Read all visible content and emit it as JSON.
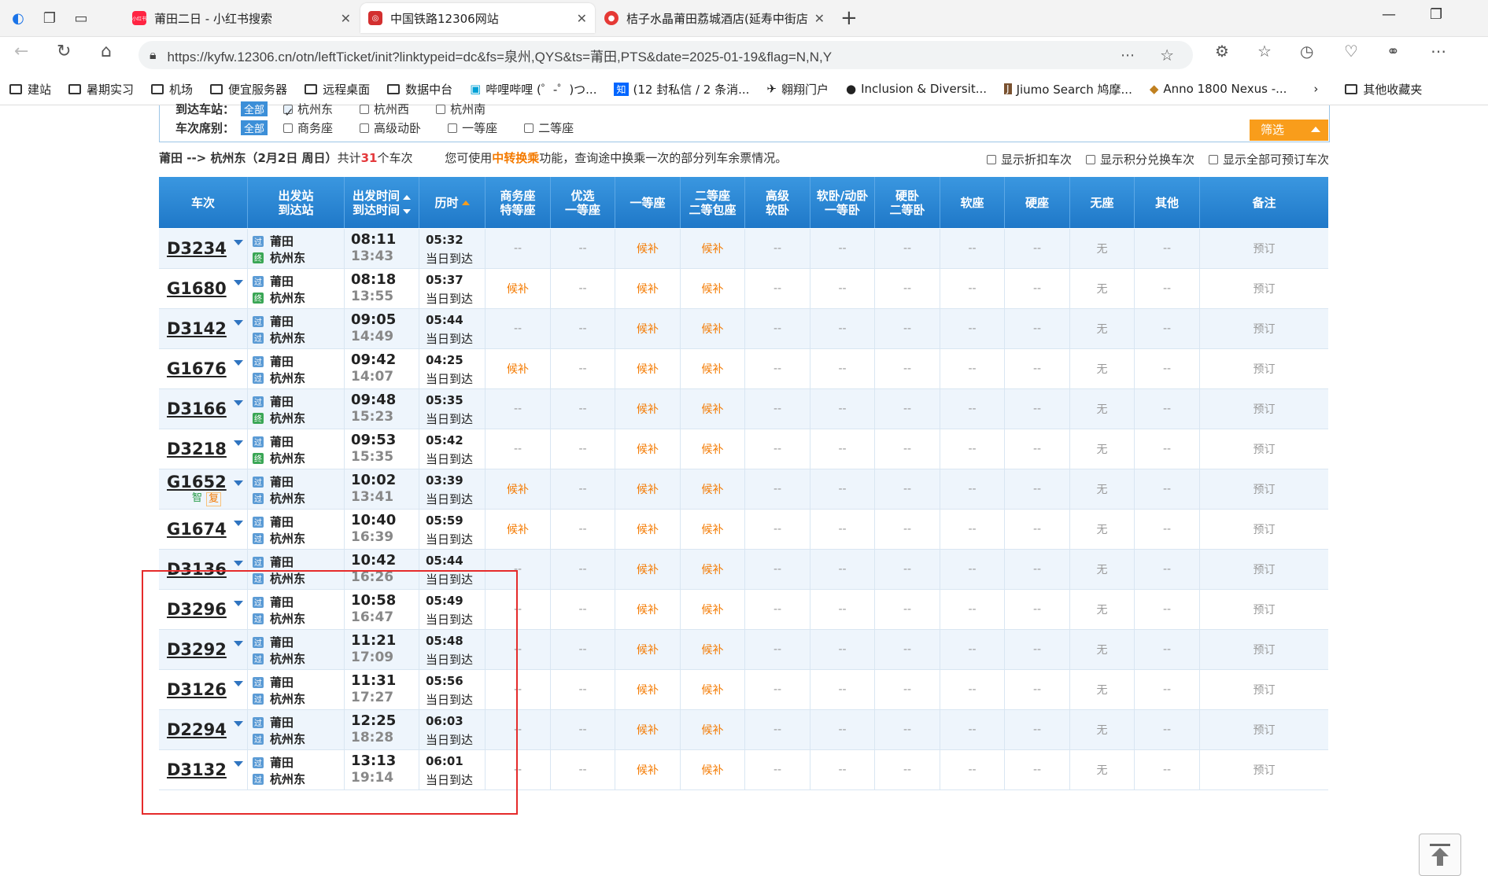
{
  "browser": {
    "tabs": [
      {
        "title": "莆田二日 - 小红书搜索",
        "fav_color": "#ff2442",
        "fav_text": "小红书"
      },
      {
        "title": "中国铁路12306网站",
        "fav_color": "#d32f2f",
        "fav_text": "◎"
      },
      {
        "title": "桔子水晶莆田荔城酒店(延寿中街店",
        "fav_color": "#e53935",
        "fav_text": "●"
      }
    ],
    "url": "https://kyfw.12306.cn/otn/leftTicket/init?linktypeid=dc&fs=泉州,QYS&ts=莆田,PTS&date=2025-01-19&flag=N,N,Y",
    "bookmarks": [
      "建站",
      "暑期实习",
      "机场",
      "便宜服务器",
      "远程桌面",
      "数据中台",
      "哔哩哔哩 (゜-゜)つ...",
      "(12 封私信 / 2 条消...",
      "翱翔门户",
      "Inclusion & Diversit...",
      "Jiumo Search 鸠摩...",
      "Anno 1800 Nexus -...",
      "其他收藏夹"
    ]
  },
  "filter": {
    "arrive_label": "到达车站：",
    "arrive_all": "全部",
    "arrive_opts": [
      "杭州东",
      "杭州西",
      "杭州南"
    ],
    "seat_label": "车次席别：",
    "seat_all": "全部",
    "seat_opts": [
      "商务座",
      "高级动卧",
      "一等座",
      "二等座"
    ],
    "screen_btn": "筛选"
  },
  "summary": {
    "route": "莆田 --> 杭州东（2月2日  周日）",
    "total_prefix": "共计",
    "total": "31",
    "total_suffix": "个车次",
    "tip1": "您可使用",
    "tip_hl": "中转换乘",
    "tip2": "功能，查询途中换乘一次的部分列车余票情况。",
    "opt1": "显示折扣车次",
    "opt2": "显示积分兑换车次",
    "opt3": "显示全部可预订车次"
  },
  "headers": {
    "train": "车次",
    "station1": "出发站",
    "station2": "到达站",
    "time1": "出发时间",
    "time2": "到达时间",
    "duration": "历时",
    "biz1": "商务座",
    "biz2": "特等座",
    "pref1": "优选",
    "pref2": "一等座",
    "first": "一等座",
    "second1": "二等座",
    "second2": "二等包座",
    "high1": "高级",
    "high2": "软卧",
    "soft1": "软卧/动卧",
    "soft2": "一等卧",
    "hard1": "硬卧",
    "hard2": "二等卧",
    "softseat": "软座",
    "hardseat": "硬座",
    "noseat": "无座",
    "other": "其他",
    "note": "备注"
  },
  "rows": [
    {
      "no": "D3234",
      "from": "莆田",
      "to": "杭州东",
      "dep": "08:11",
      "arr": "13:43",
      "dur": "05:32",
      "day": "当日到达",
      "biz": "--",
      "first": "候补",
      "second": "候补",
      "noseat": "无",
      "note": "预订",
      "to_icon": "终"
    },
    {
      "no": "G1680",
      "from": "莆田",
      "to": "杭州东",
      "dep": "08:18",
      "arr": "13:55",
      "dur": "05:37",
      "day": "当日到达",
      "biz": "候补",
      "first": "候补",
      "second": "候补",
      "noseat": "无",
      "note": "预订",
      "to_icon": "终"
    },
    {
      "no": "D3142",
      "from": "莆田",
      "to": "杭州东",
      "dep": "09:05",
      "arr": "14:49",
      "dur": "05:44",
      "day": "当日到达",
      "biz": "--",
      "first": "候补",
      "second": "候补",
      "noseat": "无",
      "note": "预订",
      "to_icon": "过"
    },
    {
      "no": "G1676",
      "from": "莆田",
      "to": "杭州东",
      "dep": "09:42",
      "arr": "14:07",
      "dur": "04:25",
      "day": "当日到达",
      "biz": "候补",
      "first": "候补",
      "second": "候补",
      "noseat": "无",
      "note": "预订",
      "to_icon": "过"
    },
    {
      "no": "D3166",
      "from": "莆田",
      "to": "杭州东",
      "dep": "09:48",
      "arr": "15:23",
      "dur": "05:35",
      "day": "当日到达",
      "biz": "--",
      "first": "候补",
      "second": "候补",
      "noseat": "无",
      "note": "预订",
      "to_icon": "终"
    },
    {
      "no": "D3218",
      "from": "莆田",
      "to": "杭州东",
      "dep": "09:53",
      "arr": "15:35",
      "dur": "05:42",
      "day": "当日到达",
      "biz": "--",
      "first": "候补",
      "second": "候补",
      "noseat": "无",
      "note": "预订",
      "to_icon": "终"
    },
    {
      "no": "G1652",
      "from": "莆田",
      "to": "杭州东",
      "dep": "10:02",
      "arr": "13:41",
      "dur": "03:39",
      "day": "当日到达",
      "biz": "候补",
      "first": "候补",
      "second": "候补",
      "noseat": "无",
      "note": "预订",
      "to_icon": "过",
      "tags": [
        "智",
        "复"
      ]
    },
    {
      "no": "G1674",
      "from": "莆田",
      "to": "杭州东",
      "dep": "10:40",
      "arr": "16:39",
      "dur": "05:59",
      "day": "当日到达",
      "biz": "候补",
      "first": "候补",
      "second": "候补",
      "noseat": "无",
      "note": "预订",
      "to_icon": "过"
    },
    {
      "no": "D3136",
      "from": "莆田",
      "to": "杭州东",
      "dep": "10:42",
      "arr": "16:26",
      "dur": "05:44",
      "day": "当日到达",
      "biz": "--",
      "first": "候补",
      "second": "候补",
      "noseat": "无",
      "note": "预订",
      "to_icon": "过"
    },
    {
      "no": "D3296",
      "from": "莆田",
      "to": "杭州东",
      "dep": "10:58",
      "arr": "16:47",
      "dur": "05:49",
      "day": "当日到达",
      "biz": "--",
      "first": "候补",
      "second": "候补",
      "noseat": "无",
      "note": "预订",
      "to_icon": "过"
    },
    {
      "no": "D3292",
      "from": "莆田",
      "to": "杭州东",
      "dep": "11:21",
      "arr": "17:09",
      "dur": "05:48",
      "day": "当日到达",
      "biz": "--",
      "first": "候补",
      "second": "候补",
      "noseat": "无",
      "note": "预订",
      "to_icon": "过"
    },
    {
      "no": "D3126",
      "from": "莆田",
      "to": "杭州东",
      "dep": "11:31",
      "arr": "17:27",
      "dur": "05:56",
      "day": "当日到达",
      "biz": "--",
      "first": "候补",
      "second": "候补",
      "noseat": "无",
      "note": "预订",
      "to_icon": "过"
    },
    {
      "no": "D2294",
      "from": "莆田",
      "to": "杭州东",
      "dep": "12:25",
      "arr": "18:28",
      "dur": "06:03",
      "day": "当日到达",
      "biz": "--",
      "first": "候补",
      "second": "候补",
      "noseat": "无",
      "note": "预订",
      "to_icon": "过"
    },
    {
      "no": "D3132",
      "from": "莆田",
      "to": "杭州东",
      "dep": "13:13",
      "arr": "19:14",
      "dur": "06:01",
      "day": "当日到达",
      "biz": "--",
      "first": "候补",
      "second": "候补",
      "noseat": "无",
      "note": "预订",
      "to_icon": "过"
    }
  ],
  "dash": "--",
  "from_icon": "过"
}
